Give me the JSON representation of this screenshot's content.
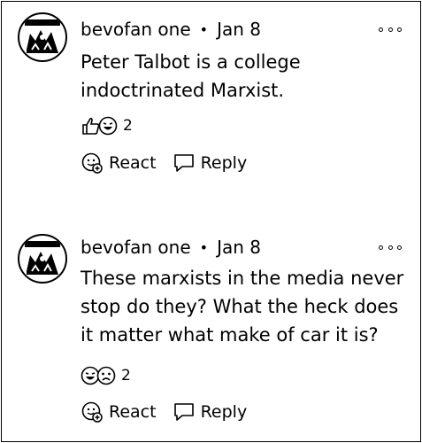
{
  "comments": [
    {
      "author": "bevofan one",
      "separator": "•",
      "date": "Jan 8",
      "text_lines": [
        "Peter Talbot is a college",
        "indoctrinated Marxist."
      ],
      "reaction_count": "2",
      "react_label": "React",
      "reply_label": "Reply",
      "icons": {
        "avatar": "avatar",
        "reactions": [
          "thumbs-up-icon",
          "laugh-icon"
        ]
      }
    },
    {
      "author": "bevofan one",
      "separator": "•",
      "date": "Jan 8",
      "text_lines": [
        "These marxists in the media never",
        "stop do they? What the heck does",
        "it matter what make of car it is?"
      ],
      "reaction_count": "2",
      "react_label": "React",
      "reply_label": "Reply",
      "icons": {
        "avatar": "avatar",
        "reactions": [
          "laugh-icon",
          "sad-icon"
        ]
      }
    }
  ]
}
